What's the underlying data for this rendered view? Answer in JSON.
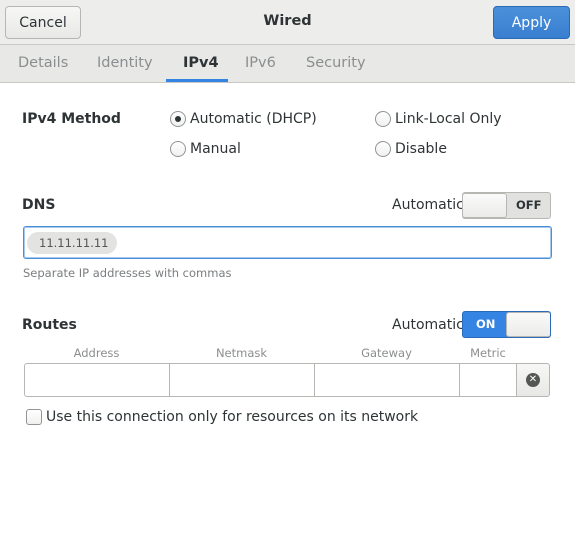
{
  "header": {
    "cancel_label": "Cancel",
    "title": "Wired",
    "apply_label": "Apply"
  },
  "tabs": [
    {
      "label": "Details"
    },
    {
      "label": "Identity"
    },
    {
      "label": "IPv4"
    },
    {
      "label": "IPv6"
    },
    {
      "label": "Security"
    }
  ],
  "active_tab": "IPv4",
  "ipv4_method": {
    "label": "IPv4 Method",
    "options": [
      {
        "label": "Automatic (DHCP)",
        "selected": true
      },
      {
        "label": "Link-Local Only",
        "selected": false
      },
      {
        "label": "Manual",
        "selected": false
      },
      {
        "label": "Disable",
        "selected": false
      }
    ]
  },
  "dns": {
    "label": "DNS",
    "automatic_label": "Automatic",
    "switch_state": "OFF",
    "entries": [
      "11.11.11.11"
    ],
    "hint": "Separate IP addresses with commas"
  },
  "routes": {
    "label": "Routes",
    "automatic_label": "Automatic",
    "switch_state": "ON",
    "columns": [
      "Address",
      "Netmask",
      "Gateway",
      "Metric"
    ]
  },
  "only_local_checkbox": {
    "label": "Use this connection only for resources on its network",
    "checked": false
  },
  "colors": {
    "accent": "#3584e4",
    "header_bg": "#ededeb",
    "text": "#2e3436"
  }
}
